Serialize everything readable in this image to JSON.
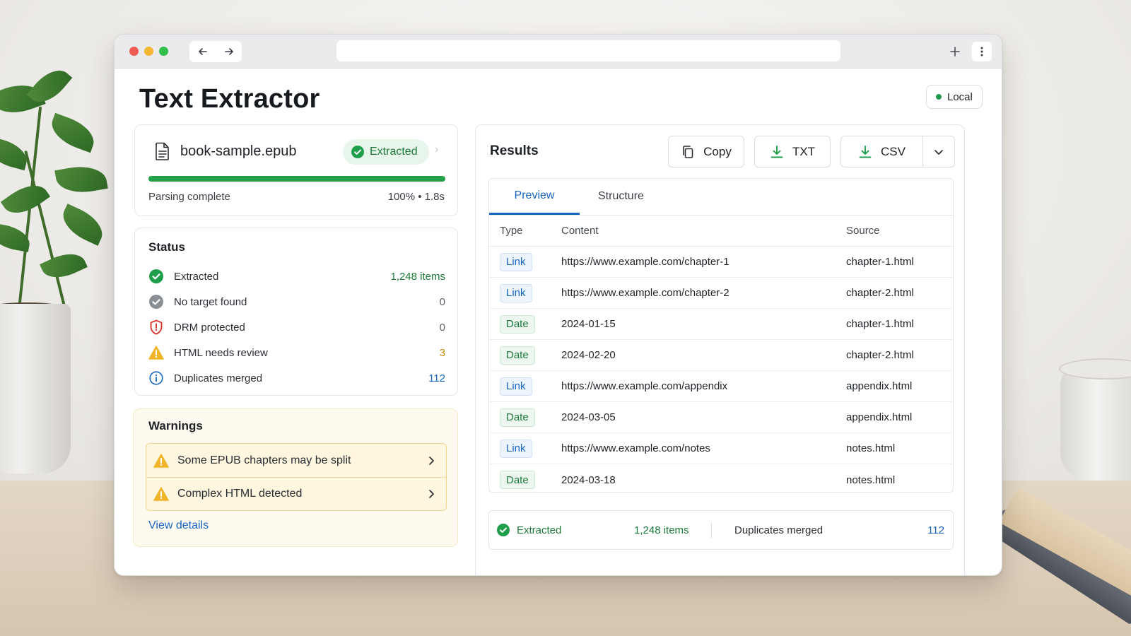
{
  "app": {
    "title": "Text Extractor",
    "mode_badge": "Local"
  },
  "colors": {
    "accent_blue": "#1666c0",
    "success_green": "#23a04a",
    "warning_amber": "#f0b429",
    "danger_red": "#d93a2f",
    "muted_gray": "#8a8f96"
  },
  "file": {
    "name": "book-sample.epub",
    "icon": "document-icon",
    "status_pill": "Extracted",
    "progress_percent": 100,
    "progress_label": "Parsing complete",
    "progress_meta": "100% • 1.8s"
  },
  "status": {
    "title": "Status",
    "items": [
      {
        "icon": "check-circle-icon",
        "label": "Extracted",
        "value": "1,248 items",
        "color": "#1b7a38"
      },
      {
        "icon": "check-circle-gray-icon",
        "label": "No target found",
        "value": "0",
        "color": "#5b616a"
      },
      {
        "icon": "shield-icon",
        "label": "DRM protected",
        "value": "0",
        "color": "#5b616a"
      },
      {
        "icon": "warning-triangle-icon",
        "label": "HTML needs review",
        "value": "3",
        "color": "#c98a00"
      },
      {
        "icon": "info-circle-icon",
        "label": "Duplicates merged",
        "value": "112",
        "color": "#1666c0"
      }
    ]
  },
  "warnings": {
    "title": "Warnings",
    "items": [
      {
        "icon": "warning-triangle-icon",
        "label": "Some EPUB chapters may be split"
      },
      {
        "icon": "warning-triangle-icon",
        "label": "Complex HTML detected"
      }
    ],
    "view_details": "View details"
  },
  "results": {
    "title": "Results",
    "buttons": {
      "copy": "Copy",
      "txt": "TXT",
      "csv": "CSV"
    },
    "tabs": [
      "Preview",
      "Structure"
    ],
    "columns": [
      "Type",
      "Content",
      "Source"
    ],
    "rows": [
      {
        "type": "Link",
        "content": "https://www.example.com/chapter-1",
        "source": "chapter-1.html"
      },
      {
        "type": "Link",
        "content": "https://www.example.com/chapter-2",
        "source": "chapter-2.html"
      },
      {
        "type": "Date",
        "content": "2024-01-15",
        "source": "chapter-1.html"
      },
      {
        "type": "Date",
        "content": "2024-02-20",
        "source": "chapter-2.html"
      },
      {
        "type": "Link",
        "content": "https://www.example.com/appendix",
        "source": "appendix.html"
      },
      {
        "type": "Date",
        "content": "2024-03-05",
        "source": "appendix.html"
      },
      {
        "type": "Link",
        "content": "https://www.example.com/notes",
        "source": "notes.html"
      },
      {
        "type": "Date",
        "content": "2024-03-18",
        "source": "notes.html"
      }
    ],
    "summary": {
      "extracted_label": "Extracted",
      "extracted_count": "1,248 items",
      "duplicates_label": "Duplicates merged",
      "duplicates_count": "112"
    }
  }
}
